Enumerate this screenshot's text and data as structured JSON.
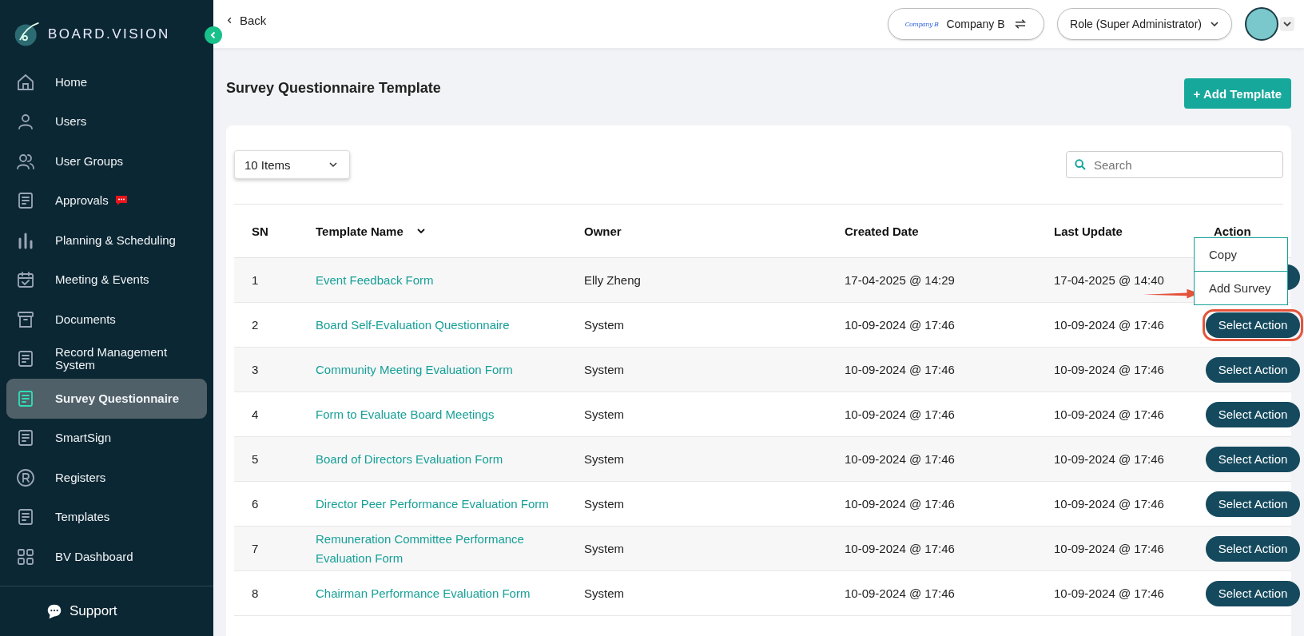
{
  "brand": {
    "name": "BOARD.VISION"
  },
  "sidebar": {
    "items": [
      {
        "label": "Home",
        "selected": false,
        "badge": false
      },
      {
        "label": "Users",
        "selected": false,
        "badge": false
      },
      {
        "label": "User Groups",
        "selected": false,
        "badge": false
      },
      {
        "label": "Approvals",
        "selected": false,
        "badge": true
      },
      {
        "label": "Planning & Scheduling",
        "selected": false,
        "badge": false
      },
      {
        "label": "Meeting & Events",
        "selected": false,
        "badge": false
      },
      {
        "label": "Documents",
        "selected": false,
        "badge": false
      },
      {
        "label": "Record Management System",
        "selected": false,
        "badge": false
      },
      {
        "label": "Survey Questionnaire",
        "selected": true,
        "badge": false
      },
      {
        "label": "SmartSign",
        "selected": false,
        "badge": false
      },
      {
        "label": "Registers",
        "selected": false,
        "badge": false
      },
      {
        "label": "Templates",
        "selected": false,
        "badge": false
      },
      {
        "label": "BV Dashboard",
        "selected": false,
        "badge": false
      }
    ],
    "support": "Support"
  },
  "header": {
    "back": "Back",
    "company_logo": "Company B",
    "company": "Company B",
    "role": "Role (Super Administrator)"
  },
  "page": {
    "title": "Survey Questionnaire Template",
    "add_button": "+ Add Template"
  },
  "toolbar": {
    "page_size": "10 Items",
    "search": {
      "placeholder": "Search"
    }
  },
  "table": {
    "columns": [
      "SN",
      "Template Name",
      "Owner",
      "Created Date",
      "Last Update",
      "Action"
    ],
    "rows": [
      {
        "sn": "1",
        "name": "Event Feedback Form",
        "owner": "Elly Zheng",
        "created": "17-04-2025 @ 14:29",
        "updated": "17-04-2025 @ 14:40",
        "menu_open": true,
        "highlighted": false
      },
      {
        "sn": "2",
        "name": "Board Self-Evaluation Questionnaire",
        "owner": "System",
        "created": "10-09-2024 @ 17:46",
        "updated": "10-09-2024 @ 17:46",
        "action": "Select Action",
        "menu_open": false,
        "highlighted": true
      },
      {
        "sn": "3",
        "name": "Community Meeting Evaluation Form",
        "owner": "System",
        "created": "10-09-2024 @ 17:46",
        "updated": "10-09-2024 @ 17:46",
        "action": "Select Action",
        "menu_open": false,
        "highlighted": false
      },
      {
        "sn": "4",
        "name": "Form to Evaluate Board Meetings",
        "owner": "System",
        "created": "10-09-2024 @ 17:46",
        "updated": "10-09-2024 @ 17:46",
        "action": "Select Action",
        "menu_open": false,
        "highlighted": false
      },
      {
        "sn": "5",
        "name": "Board of Directors Evaluation Form",
        "owner": "System",
        "created": "10-09-2024 @ 17:46",
        "updated": "10-09-2024 @ 17:46",
        "action": "Select Action",
        "menu_open": false,
        "highlighted": false
      },
      {
        "sn": "6",
        "name": "Director Peer Performance Evaluation Form",
        "owner": "System",
        "created": "10-09-2024 @ 17:46",
        "updated": "10-09-2024 @ 17:46",
        "action": "Select Action",
        "menu_open": false,
        "highlighted": false
      },
      {
        "sn": "7",
        "name": "Remuneration Committee Performance Evaluation Form",
        "owner": "System",
        "created": "10-09-2024 @ 17:46",
        "updated": "10-09-2024 @ 17:46",
        "action": "Select Action",
        "menu_open": false,
        "highlighted": false
      },
      {
        "sn": "8",
        "name": "Chairman Performance Evaluation Form",
        "owner": "System",
        "created": "10-09-2024 @ 17:46",
        "updated": "10-09-2024 @ 17:46",
        "action": "Select Action",
        "menu_open": false,
        "highlighted": false
      }
    ]
  },
  "action_menu": {
    "items": [
      "Copy",
      "Add Survey"
    ]
  }
}
